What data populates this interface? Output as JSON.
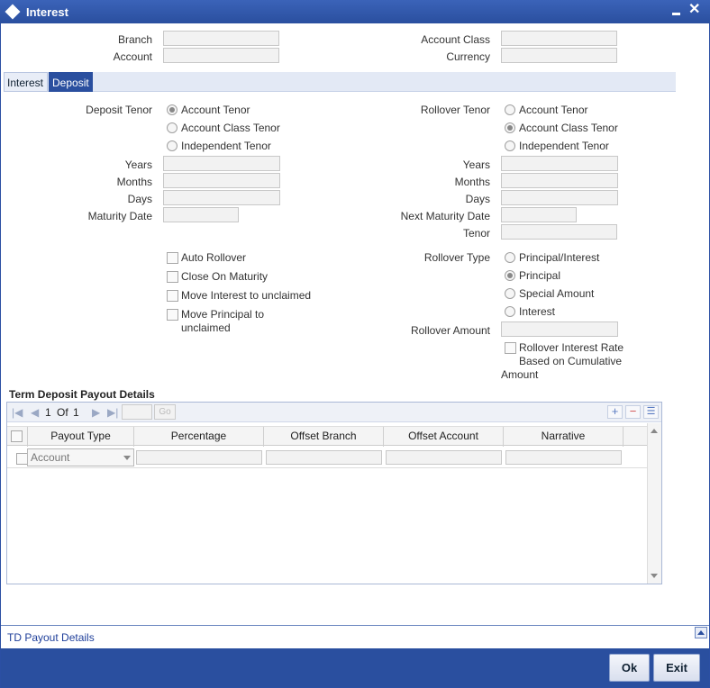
{
  "window": {
    "title": "Interest"
  },
  "header": {
    "branch_label": "Branch",
    "account_label": "Account",
    "account_class_label": "Account Class",
    "currency_label": "Currency"
  },
  "tabs": [
    {
      "label": "Interest",
      "active": false
    },
    {
      "label": "Deposit",
      "active": true
    }
  ],
  "deposit_tenor": {
    "label": "Deposit Tenor",
    "options": [
      "Account Tenor",
      "Account Class Tenor",
      "Independent Tenor"
    ],
    "selected": "Account Tenor",
    "years_label": "Years",
    "months_label": "Months",
    "days_label": "Days",
    "maturity_date_label": "Maturity Date"
  },
  "rollover_tenor": {
    "label": "Rollover Tenor",
    "options": [
      "Account Tenor",
      "Account Class Tenor",
      "Independent Tenor"
    ],
    "selected": "Account Class Tenor",
    "years_label": "Years",
    "months_label": "Months",
    "days_label": "Days",
    "next_maturity_date_label": "Next Maturity Date",
    "tenor_label": "Tenor"
  },
  "checkboxes": {
    "auto_rollover": "Auto Rollover",
    "close_on_maturity": "Close On Maturity",
    "move_interest": "Move Interest to unclaimed",
    "move_principal_1": "Move Principal to",
    "move_principal_2": "unclaimed"
  },
  "rollover_type": {
    "label": "Rollover Type",
    "options": [
      "Principal/Interest",
      "Principal",
      "Special Amount",
      "Interest"
    ],
    "selected": "Principal",
    "amount_label": "Rollover Amount",
    "rate_line1": "Rollover Interest Rate",
    "rate_line2": "Based on Cumulative",
    "rate_line3": "Amount"
  },
  "payout": {
    "title": "Term Deposit Payout Details",
    "pager": {
      "current": "1",
      "of_label": "Of",
      "total": "1",
      "go_label": "Go"
    },
    "columns": [
      "Payout Type",
      "Percentage",
      "Offset Branch",
      "Offset Account",
      "Narrative"
    ],
    "row": {
      "payout_type": "Account"
    }
  },
  "footer": {
    "link": "TD Payout Details",
    "ok": "Ok",
    "exit": "Exit"
  },
  "colors": {
    "titlebar": "#2a4f9f",
    "tab_active": "#2a4f9f",
    "bottombar": "#2a4f9f"
  }
}
